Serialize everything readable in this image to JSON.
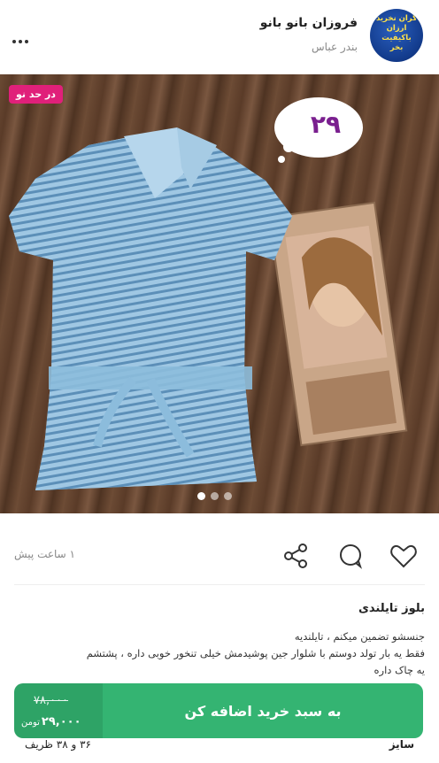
{
  "header": {
    "shop_name": "فروزان بانو بانو",
    "city": "بندر عباس",
    "avatar_text": [
      "گران نخرید",
      "ارزان",
      "باکیفیت",
      "بخر"
    ]
  },
  "photo": {
    "badge": "در حد نو",
    "cloud_number": "۲۹",
    "carousel_count": 3
  },
  "actions": {
    "time_ago": "۱ ساعت پیش"
  },
  "product": {
    "title": "بلوز تایلندی",
    "description": [
      "جنسشو تضمین میکنم ، تایلندیه",
      "فقط یه بار تولد دوستم با شلوار جین پوشیدمش خیلی تنخور خوبی داره ، پشتشم",
      "یه چاک داره"
    ],
    "size_label": "سایز",
    "size_value": "۳۶ و ۳۸ ظریف"
  },
  "cart": {
    "button_label": "به سبد خرید اضافه کن",
    "old_price": "۷۸,۰۰۰",
    "new_price": "۲۹,۰۰۰",
    "currency": "تومن"
  },
  "colors": {
    "cart_green": "#34b472",
    "badge_pink": "#e0207a"
  }
}
